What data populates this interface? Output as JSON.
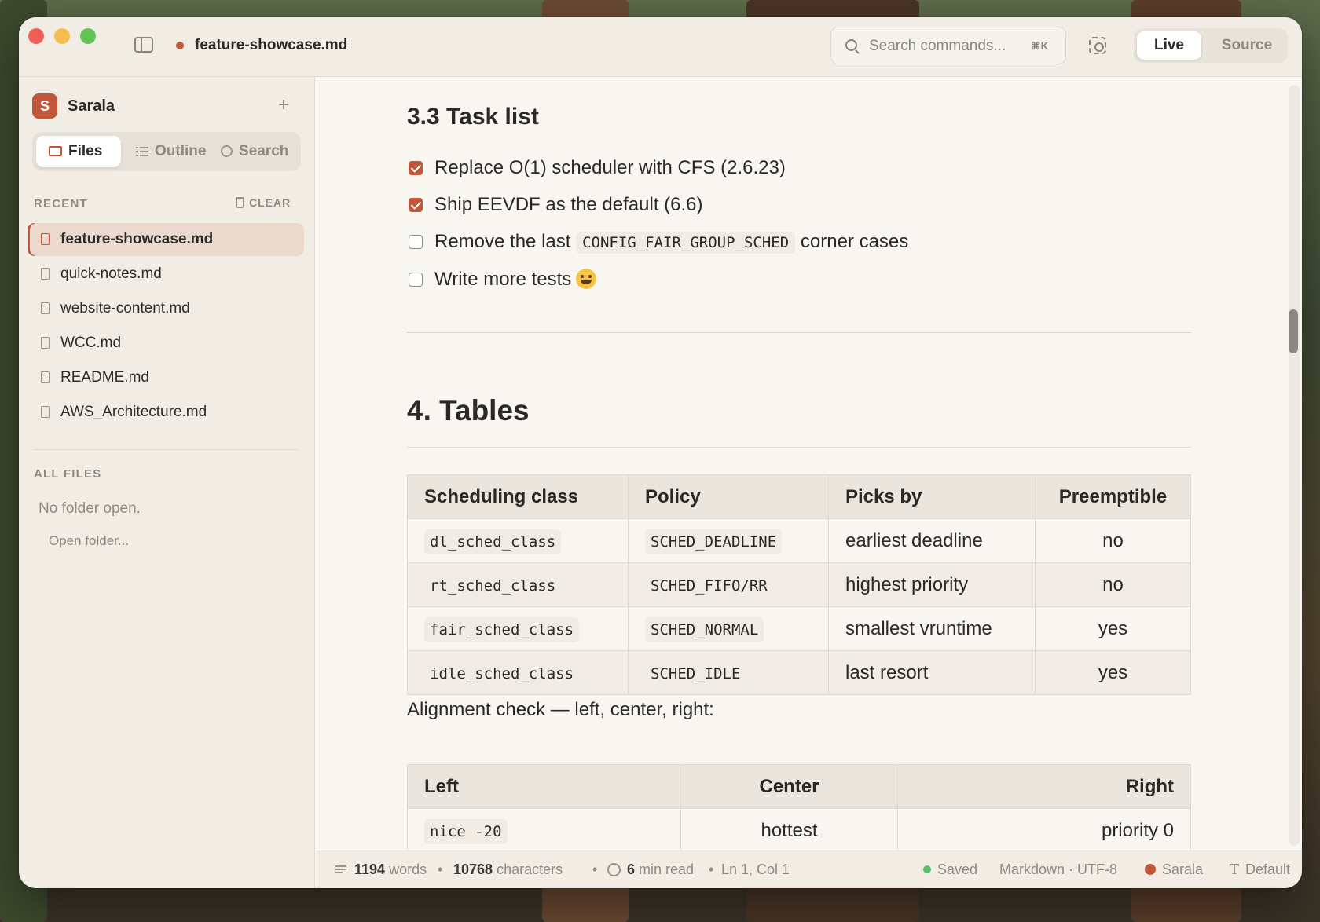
{
  "window": {
    "doc_title": "feature-showcase.md",
    "command_search": {
      "placeholder": "Search commands...",
      "shortcut": "⌘K"
    },
    "mode_toggle": {
      "live": "Live",
      "source": "Source",
      "active": "Live"
    }
  },
  "sidebar": {
    "workspace": {
      "initial": "S",
      "name": "Sarala",
      "add": "+"
    },
    "tabs": [
      {
        "label": "Files",
        "icon": "folder-icon",
        "active": true
      },
      {
        "label": "Outline",
        "icon": "list-icon",
        "active": false
      },
      {
        "label": "Search",
        "icon": "search-icon",
        "active": false
      }
    ],
    "recent_label": "RECENT",
    "clear_label": "CLEAR",
    "recent_files": [
      {
        "name": "feature-showcase.md",
        "active": true
      },
      {
        "name": "quick-notes.md",
        "active": false
      },
      {
        "name": "website-content.md",
        "active": false
      },
      {
        "name": "WCC.md",
        "active": false
      },
      {
        "name": "README.md",
        "active": false
      },
      {
        "name": "AWS_Architecture.md",
        "active": false
      }
    ],
    "all_files_label": "ALL FILES",
    "no_folder": "No folder open.",
    "open_folder": "Open folder..."
  },
  "document": {
    "task_heading": "3.3 Task list",
    "tasks": [
      {
        "checked": true,
        "text": "Replace O(1) scheduler with CFS (2.6.23)"
      },
      {
        "checked": true,
        "text": "Ship EEVDF as the default (6.6)"
      },
      {
        "checked": false,
        "before": "Remove the last",
        "code": "CONFIG_FAIR_GROUP_SCHED",
        "after": "corner cases"
      },
      {
        "checked": false,
        "text": "Write more tests",
        "emoji": "grinning-sweat-face"
      }
    ],
    "tables_heading": "4. Tables",
    "sched_table": {
      "headers": [
        "Scheduling class",
        "Policy",
        "Picks by",
        "Preemptible"
      ],
      "rows": [
        [
          "dl_sched_class",
          "SCHED_DEADLINE",
          "earliest deadline",
          "no"
        ],
        [
          "rt_sched_class",
          "SCHED_FIFO/RR",
          "highest priority",
          "no"
        ],
        [
          "fair_sched_class",
          "SCHED_NORMAL",
          "smallest vruntime",
          "yes"
        ],
        [
          "idle_sched_class",
          "SCHED_IDLE",
          "last resort",
          "yes"
        ]
      ]
    },
    "alignment_text": "Alignment check — left, center, right:",
    "align_table": {
      "headers": [
        "Left",
        "Center",
        "Right"
      ],
      "rows": [
        [
          "nice -20",
          "hottest",
          "priority 0"
        ]
      ]
    }
  },
  "status": {
    "words_value": "1194",
    "words_label": "words",
    "chars_value": "10768",
    "chars_label": "characters",
    "read_value": "6",
    "read_label": "min read",
    "position": "Ln 1, Col 1",
    "saved": "Saved",
    "format": "Markdown · UTF-8",
    "user": "Sarala",
    "theme": "Default"
  },
  "colors": {
    "accent": "#c0573a",
    "saved_green": "#5bbd6a",
    "background": "#f8f6f1"
  }
}
